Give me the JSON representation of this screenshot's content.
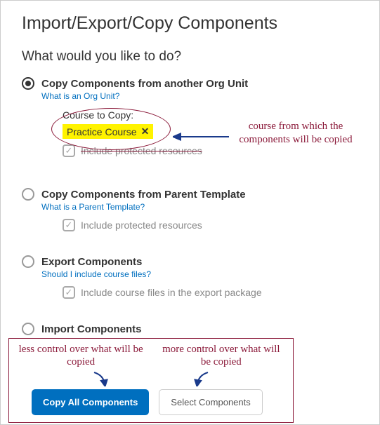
{
  "page_title": "Import/Export/Copy Components",
  "subtitle": "What would you like to do?",
  "options": {
    "copy_org": {
      "label": "Copy Components from another Org Unit",
      "help": "What is an Org Unit?",
      "course_to_copy_label": "Course to Copy:",
      "selected_course": "Practice Course",
      "include_protected": "Include protected resources"
    },
    "copy_parent": {
      "label": "Copy Components from Parent Template",
      "help": "What is a Parent Template?",
      "include_protected": "Include protected resources"
    },
    "export": {
      "label": "Export Components",
      "help": "Should I include course files?",
      "include_files": "Include course files in the export package"
    },
    "import": {
      "label": "Import Components"
    }
  },
  "annotations": {
    "source": "course from which the components will be copied",
    "less_control": "less control over what will be copied",
    "more_control": "more control over what will be copied"
  },
  "buttons": {
    "copy_all": "Copy All Components",
    "select": "Select Components"
  }
}
